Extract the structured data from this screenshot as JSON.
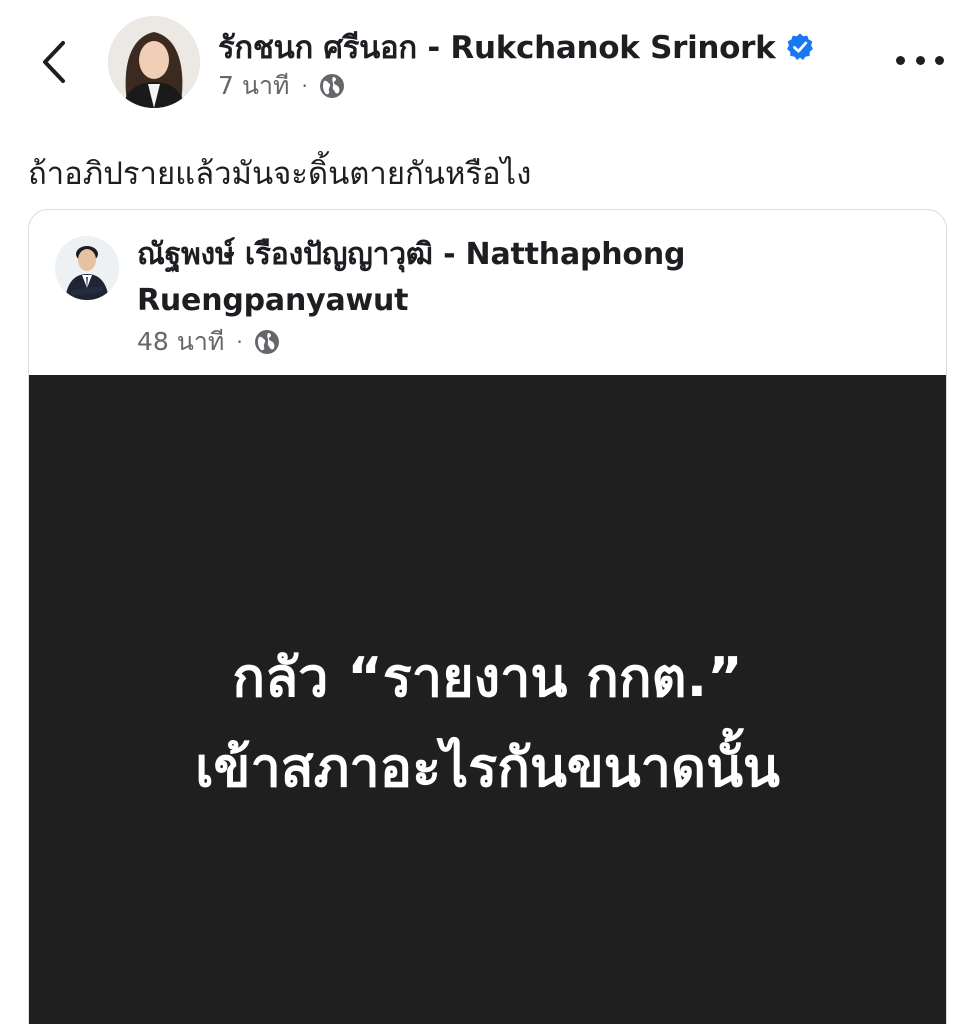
{
  "header": {
    "back_icon": "chevron-left-icon",
    "author_name": "รักชนก ศรีนอก - Rukchanok Srinork",
    "verified_icon": "verified-badge-icon",
    "time": "7 นาที",
    "separator": "·",
    "privacy_icon": "globe-icon",
    "more_icon": "more-horizontal-icon"
  },
  "post": {
    "text": "ถ้าอภิปรายแล้วมันจะดิ้นตายกันหรือไง"
  },
  "shared_post": {
    "author_name": "ณัฐพงษ์ เรืองปัญญาวุฒิ - Natthaphong Ruengpanyawut",
    "time": "48 นาที",
    "separator": "·",
    "privacy_icon": "globe-icon",
    "image": {
      "line1": "กลัว “รายงาน กกต.”",
      "line2": "เข้าสภาอะไรกันขนาดนั้น",
      "background_color": "#1f1f1f",
      "text_color": "#ffffff"
    }
  },
  "colors": {
    "verified_blue": "#1877f2",
    "secondary_text": "#65676b",
    "primary_text": "#1c1e21",
    "card_border": "#dadde1"
  }
}
